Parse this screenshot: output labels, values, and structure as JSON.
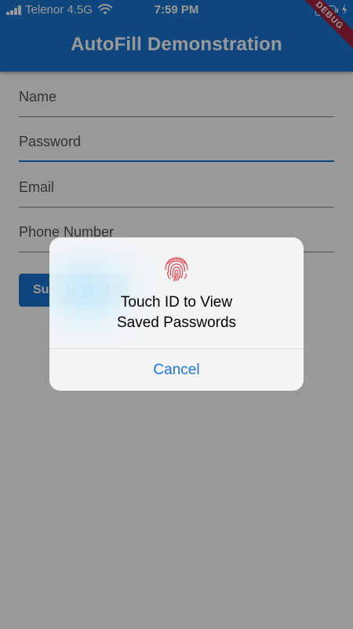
{
  "status_bar": {
    "carrier": "Telenor 4.5G",
    "time": "7:59 PM",
    "battery_color": "#6bd66b"
  },
  "app_bar": {
    "title": "AutoFill Demonstration",
    "color": "#1976d2",
    "debug_label": "DEBUG"
  },
  "form": {
    "fields": [
      {
        "label": "Name"
      },
      {
        "label": "Password"
      },
      {
        "label": "Email"
      },
      {
        "label": "Phone Number"
      }
    ],
    "submit_label": "Submit"
  },
  "dialog": {
    "icon": "fingerprint-icon",
    "title_line1": "Touch ID to View",
    "title_line2": "Saved Passwords",
    "cancel_label": "Cancel",
    "accent_color": "#1a73e8"
  }
}
